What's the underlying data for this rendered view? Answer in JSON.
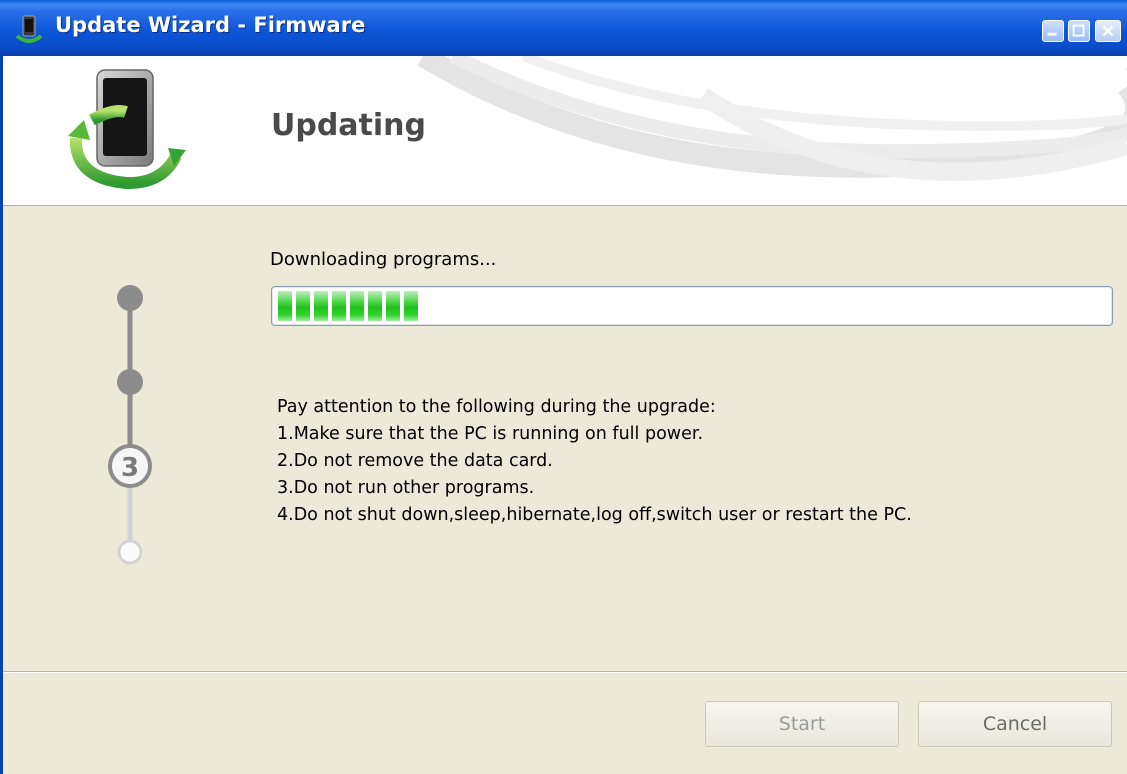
{
  "window": {
    "title": "Update Wizard - Firmware"
  },
  "header": {
    "title": "Updating"
  },
  "progress": {
    "status_text": "Downloading programs...",
    "segments_filled": 8,
    "fraction": 0.17
  },
  "steps": {
    "current_step_label": "3",
    "total_steps": 4,
    "current_step": 3
  },
  "notes": {
    "heading": "Pay attention to the following during the upgrade:",
    "items": [
      "1.Make sure that the PC is running on full power.",
      "2.Do not remove the data card.",
      "3.Do not run other programs.",
      "4.Do not shut down,sleep,hibernate,log off,switch user or restart the PC."
    ]
  },
  "buttons": {
    "start_label": "Start",
    "cancel_label": "Cancel"
  },
  "colors": {
    "title_bar": "#0d56d8",
    "progress_green": "#22c01f",
    "dialog_bg": "#ece9d8"
  }
}
